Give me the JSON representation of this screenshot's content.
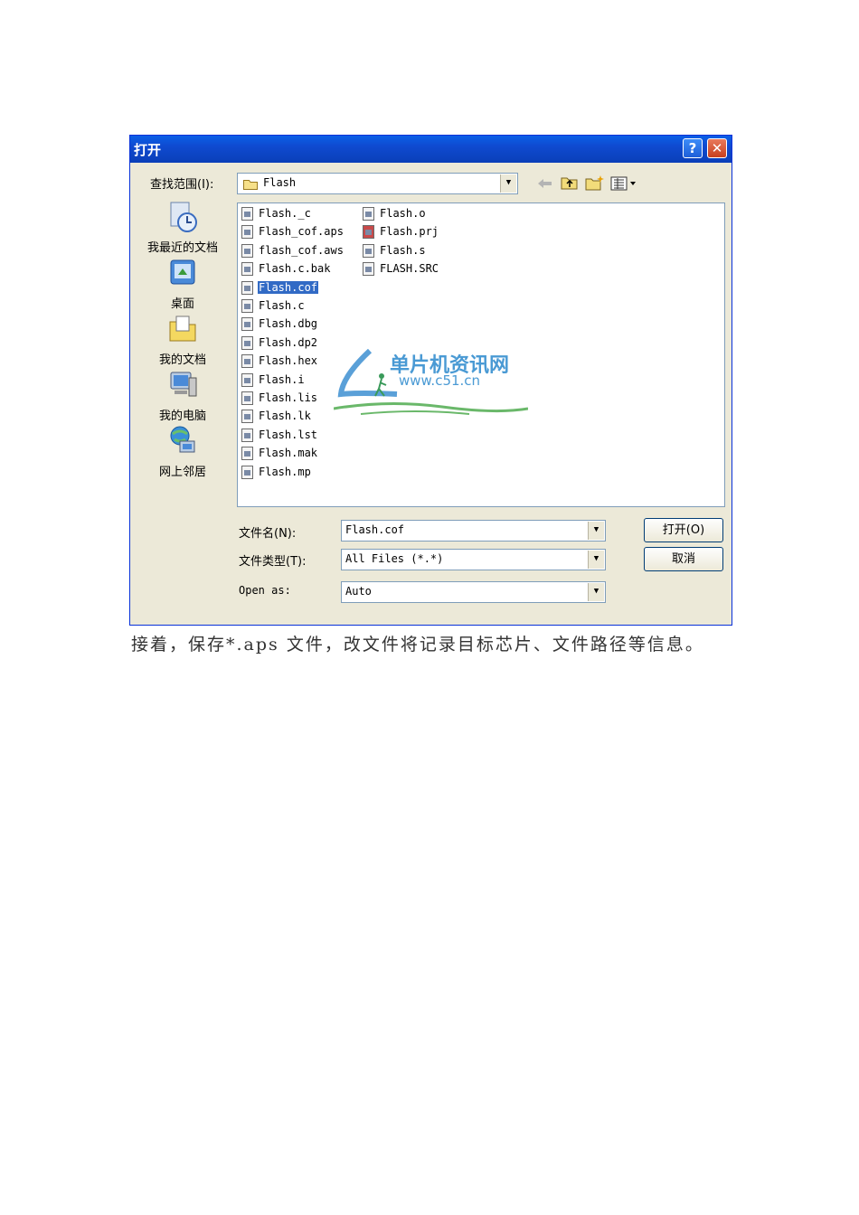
{
  "dialog": {
    "title": "打开",
    "help_label": "?",
    "close_label": "✕",
    "look_in_label": "查找范围(I):",
    "look_in_value": "Flash",
    "places": [
      "我最近的文档",
      "桌面",
      "我的文档",
      "我的电脑",
      "网上邻居"
    ],
    "files_col1": [
      "Flash._c",
      "Flash_cof.aps",
      "flash_cof.aws",
      "Flash.c.bak",
      "Flash.cof",
      "Flash.c",
      "Flash.dbg",
      "Flash.dp2",
      "Flash.hex",
      "Flash.i",
      "Flash.lis",
      "Flash.lk",
      "Flash.lst",
      "Flash.mak",
      "Flash.mp"
    ],
    "files_col2": [
      "Flash.o",
      "Flash.prj",
      "Flash.s",
      "FLASH.SRC"
    ],
    "selected_file": "Flash.cof",
    "filename_label": "文件名(N):",
    "filename_value": "Flash.cof",
    "filetype_label": "文件类型(T):",
    "filetype_value": "All Files (*.*)",
    "openas_label": "Open as:",
    "openas_value": "Auto",
    "open_button": "打开(O)",
    "cancel_button": "取消"
  },
  "watermark": {
    "title": "单片机资讯网",
    "url": "www.c51.cn"
  },
  "caption": "接着，保存*.aps 文件，改文件将记录目标芯片、文件路径等信息。"
}
